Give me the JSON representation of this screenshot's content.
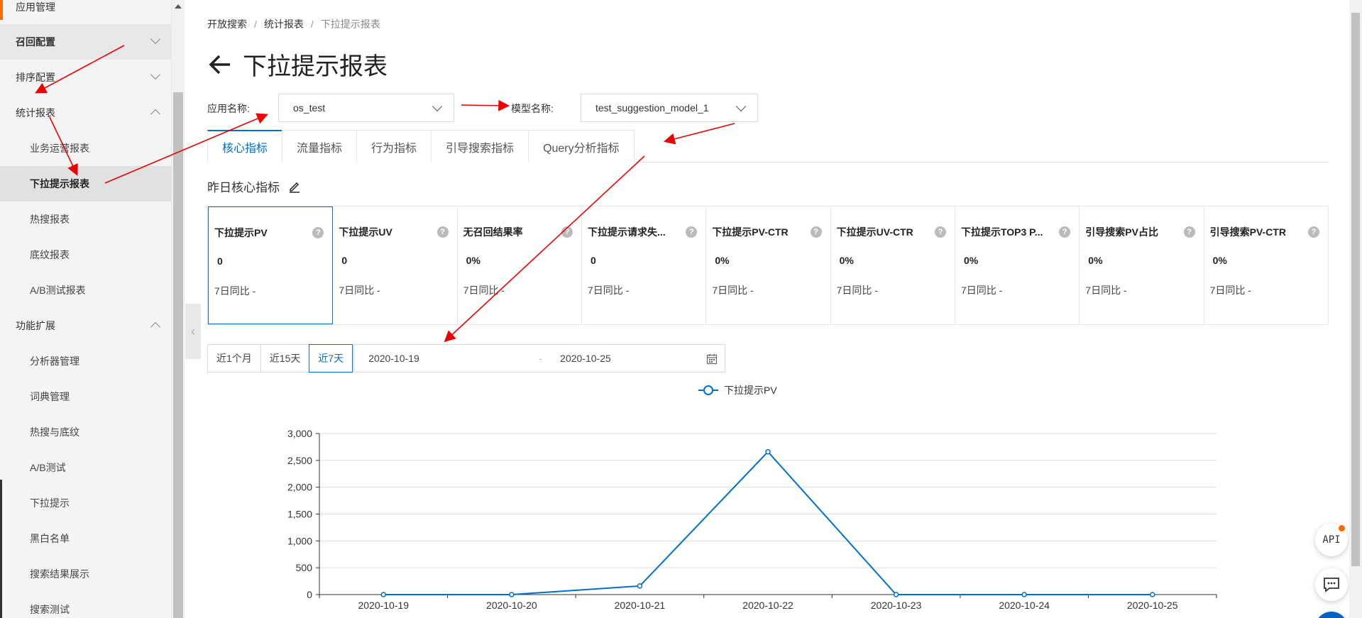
{
  "sidebar": {
    "items": [
      {
        "label": "应用管理"
      },
      {
        "label": "召回配置"
      },
      {
        "label": "排序配置"
      },
      {
        "label": "统计报表"
      },
      {
        "label": "业务运营报表"
      },
      {
        "label": "下拉提示报表"
      },
      {
        "label": "热搜报表"
      },
      {
        "label": "底纹报表"
      },
      {
        "label": "A/B测试报表"
      },
      {
        "label": "功能扩展"
      },
      {
        "label": "分析器管理"
      },
      {
        "label": "词典管理"
      },
      {
        "label": "热搜与底纹"
      },
      {
        "label": "A/B测试"
      },
      {
        "label": "下拉提示"
      },
      {
        "label": "黑白名单"
      },
      {
        "label": "搜索结果展示"
      },
      {
        "label": "搜索测试"
      }
    ]
  },
  "breadcrumb": {
    "items": [
      "开放搜索",
      "统计报表",
      "下拉提示报表"
    ]
  },
  "page": {
    "title": "下拉提示报表"
  },
  "filters": {
    "app_label": "应用名称:",
    "app_value": "os_test",
    "model_label": "模型名称:",
    "model_value": "test_suggestion_model_1"
  },
  "tabs": [
    "核心指标",
    "流量指标",
    "行为指标",
    "引导搜索指标",
    "Query分析指标"
  ],
  "section": {
    "title": "昨日核心指标"
  },
  "metrics": [
    {
      "name": "下拉提示PV",
      "value": "0",
      "compare": "7日同比 -"
    },
    {
      "name": "下拉提示UV",
      "value": "0",
      "compare": "7日同比 -"
    },
    {
      "name": "无召回结果率",
      "value": "0%",
      "compare": "7日同比 -"
    },
    {
      "name": "下拉提示请求失...",
      "value": "0",
      "compare": "7日同比 -"
    },
    {
      "name": "下拉提示PV-CTR",
      "value": "0%",
      "compare": "7日同比 -"
    },
    {
      "name": "下拉提示UV-CTR",
      "value": "0%",
      "compare": "7日同比 -"
    },
    {
      "name": "下拉提示TOP3 P...",
      "value": "0%",
      "compare": "7日同比 -"
    },
    {
      "name": "引导搜索PV占比",
      "value": "0%",
      "compare": "7日同比 -"
    },
    {
      "name": "引导搜索PV-CTR",
      "value": "0%",
      "compare": "7日同比 -"
    }
  ],
  "date_range": {
    "quick": [
      "近1个月",
      "近15天",
      "近7天"
    ],
    "start": "2020-10-19",
    "separator": "-",
    "end": "2020-10-25"
  },
  "chart_data": {
    "type": "line",
    "categories": [
      "2020-10-19",
      "2020-10-20",
      "2020-10-21",
      "2020-10-22",
      "2020-10-23",
      "2020-10-24",
      "2020-10-25"
    ],
    "series": [
      {
        "name": "下拉提示PV",
        "values": [
          0,
          0,
          160,
          2660,
          0,
          0,
          0
        ]
      }
    ],
    "ylim": [
      0,
      3000
    ],
    "yticks": [
      0,
      500,
      1000,
      1500,
      2000,
      2500,
      3000
    ],
    "ytick_labels": [
      "0",
      "500",
      "1,000",
      "1,500",
      "2,000",
      "2,500",
      "3,000"
    ],
    "legend_position": "top-center",
    "grid": true,
    "color": "#0070cc"
  },
  "floating": {
    "api_label": "API"
  }
}
